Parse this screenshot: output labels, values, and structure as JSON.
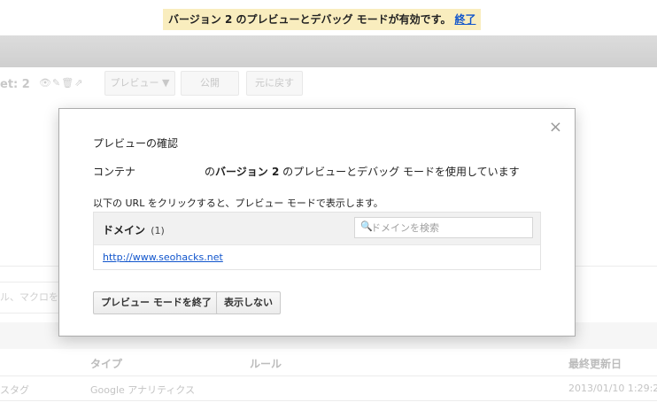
{
  "notice": {
    "text": "バージョン 2 のプレビューとデバッグ モードが有効です。",
    "end_link": "終了"
  },
  "background": {
    "title": "et: 2",
    "icons": [
      "eye-icon",
      "pencil-icon",
      "trash-icon",
      "share-icon"
    ],
    "preview_button": "プレビュー ▼",
    "publish_button": "公開",
    "revert_button": "元に戻す",
    "search_placeholder": "ル、マクロを検",
    "table_headers": {
      "type": "タイプ",
      "rule": "ルール",
      "updated": "最終更新日"
    },
    "row": {
      "name": "スタグ",
      "type": "Google アナリティクス",
      "updated": "2013/01/10 1:29:2"
    }
  },
  "modal": {
    "close_symbol": "×",
    "title": "プレビューの確認",
    "desc_prefix": "コンテナ",
    "desc_mid": "の",
    "version_label": "バージョン 2",
    "desc_suffix": "のプレビューとデバッグ モードを使用しています",
    "instruction": "以下の URL をクリックすると、プレビュー モードで表示します。",
    "domain_title": "ドメイン",
    "domain_count": "(1)",
    "search_placeholder": "ドメインを検索",
    "domains": [
      "http://www.seohacks.net"
    ],
    "end_preview_button": "プレビュー モードを終了",
    "hide_button": "表示しない"
  }
}
